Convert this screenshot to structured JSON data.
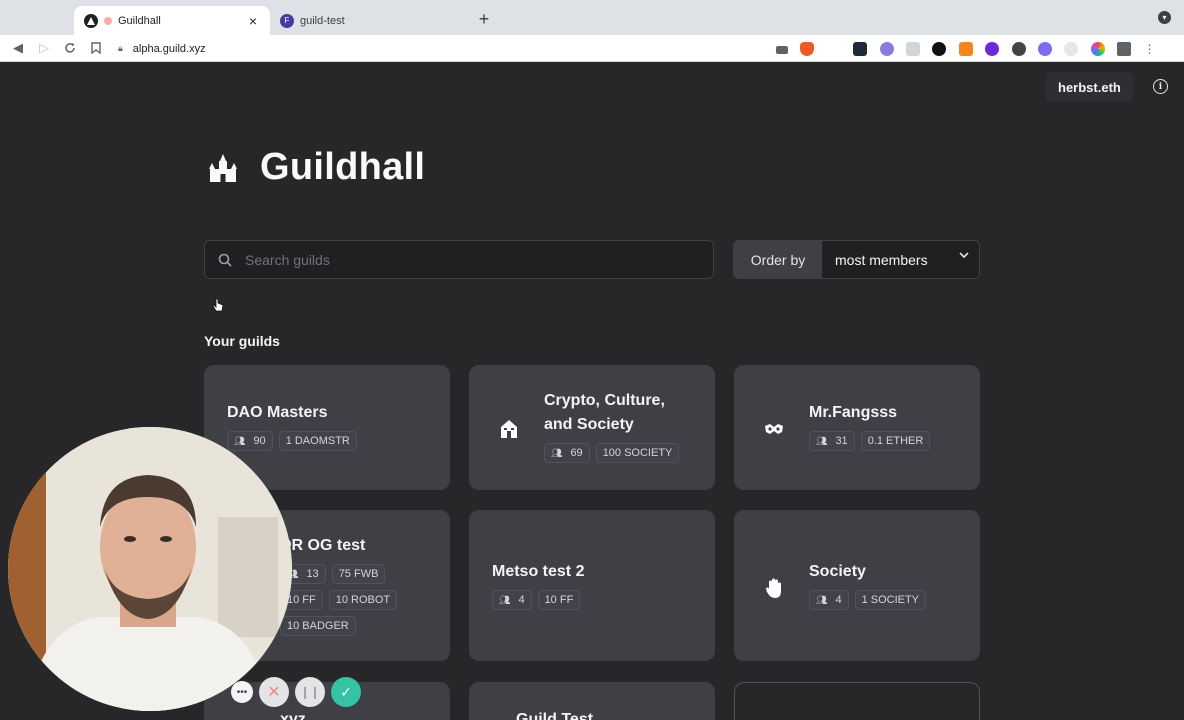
{
  "browser": {
    "tabs": [
      {
        "title": "Guildhall",
        "active": true
      },
      {
        "title": "guild-test",
        "active": false
      }
    ],
    "url": "alpha.guild.xyz",
    "extensions": [
      "camera-icon",
      "brave-icon",
      "blank-icon",
      "dark-icon",
      "video-icon",
      "black-circle-icon",
      "metamask-icon",
      "purple-icon",
      "w-icon",
      "settings-icon",
      "light-icon",
      "colorwheel-icon",
      "puzzle-icon"
    ]
  },
  "header": {
    "account": "herbst.eth"
  },
  "brand": {
    "title": "Guildhall"
  },
  "search": {
    "placeholder": "Search guilds"
  },
  "order": {
    "label": "Order by",
    "selected": "most members"
  },
  "section": {
    "your_guilds": "Your guilds"
  },
  "guilds": [
    {
      "name_lines": [
        "DAO Masters"
      ],
      "members": "90",
      "tags": [
        "1 DAOMSTR"
      ],
      "icon": "none"
    },
    {
      "name_lines": [
        "Crypto, Culture,",
        "and Society"
      ],
      "members": "69",
      "tags": [
        "100 SOCIETY"
      ],
      "icon": "house-icon"
    },
    {
      "name_lines": [
        "Mr.Fangsss"
      ],
      "members": "31",
      "tags": [
        "0.1 ETHER"
      ],
      "icon": "mask-icon"
    },
    {
      "name_lines": [
        "DR OG test"
      ],
      "members": "13",
      "tags": [
        "75 FWB",
        "10 FF",
        "10 ROBOT",
        "10 BADGER"
      ],
      "icon": "none"
    },
    {
      "name_lines": [
        "Metso test 2"
      ],
      "members": "4",
      "tags": [
        "10 FF"
      ],
      "icon": "none"
    },
    {
      "name_lines": [
        "Society"
      ],
      "members": "4",
      "tags": [
        "1 SOCIETY"
      ],
      "icon": "hand-icon"
    },
    {
      "name_lines": [
        "xyz"
      ],
      "members": "",
      "tags": [],
      "icon": "none"
    },
    {
      "name_lines": [
        "Guild Test"
      ],
      "members": "",
      "tags": [],
      "icon": "none"
    }
  ],
  "colors": {
    "page_bg": "#27272a",
    "card_bg": "#3f3f46",
    "accent_done": "#34c3a3"
  }
}
